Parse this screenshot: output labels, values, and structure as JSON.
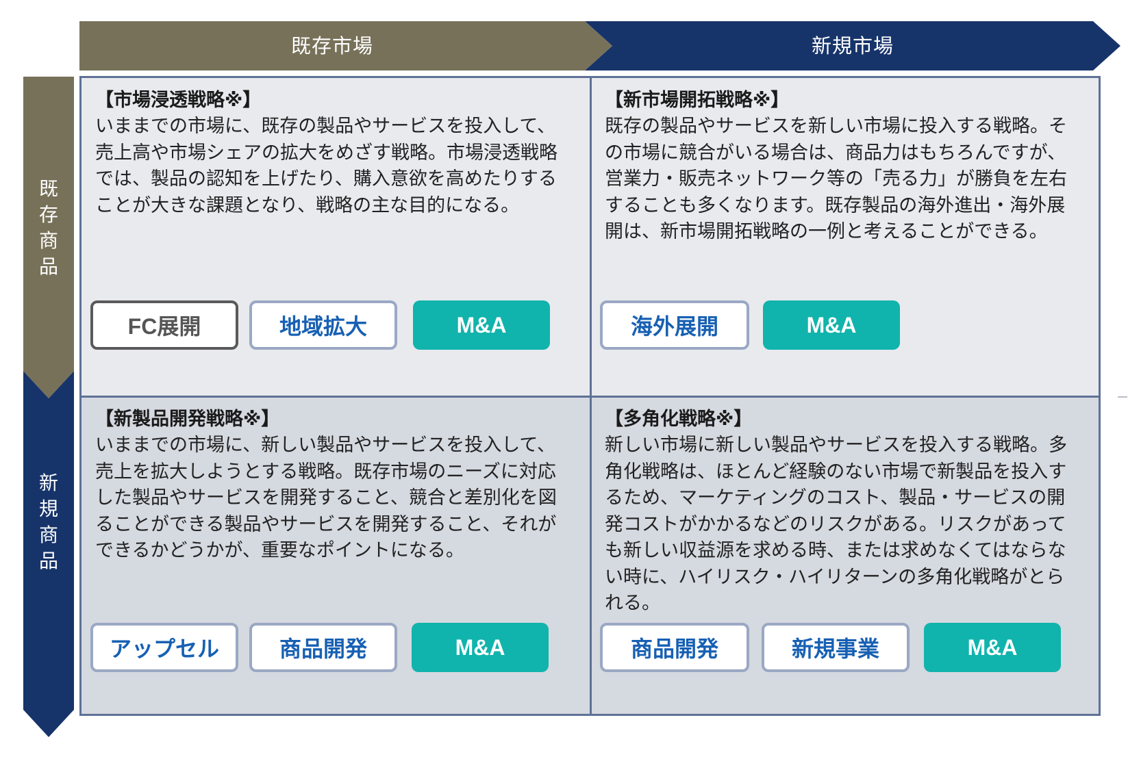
{
  "columns": {
    "existing_market": "既存市場",
    "new_market": "新規市場"
  },
  "rows": {
    "existing_product": "既存商品",
    "new_product": "新規商品"
  },
  "colors": {
    "olive": "#777159",
    "navy": "#17346a",
    "teal": "#10b4ac",
    "blue_text": "#1760b3",
    "border": "#5e7196"
  },
  "cells": {
    "market_penetration": {
      "title": "【市場浸透戦略※】",
      "body": "いままでの市場に、既存の製品やサービスを投入して、売上高や市場シェアの拡大をめざす戦略。市場浸透戦略では、製品の認知を上げたり、購入意欲を高めたりすることが大きな課題となり、戦略の主な目的になる。",
      "buttons": [
        "FC展開",
        "地域拡大",
        "M&A"
      ]
    },
    "market_development": {
      "title": "【新市場開拓戦略※】",
      "body": "既存の製品やサービスを新しい市場に投入する戦略。その市場に競合がいる場合は、商品力はもちろんですが、営業力・販売ネットワーク等の「売る力」が勝負を左右することも多くなります。既存製品の海外進出・海外展開は、新市場開拓戦略の一例と考えることができる。",
      "buttons": [
        "海外展開",
        "M&A"
      ]
    },
    "product_development": {
      "title": "【新製品開発戦略※】",
      "body": "いままでの市場に、新しい製品やサービスを投入して、売上を拡大しようとする戦略。既存市場のニーズに対応した製品やサービスを開発すること、競合と差別化を図ることができる製品やサービスを開発すること、それができるかどうかが、重要なポイントになる。",
      "buttons": [
        "アップセル",
        "商品開発",
        "M&A"
      ]
    },
    "diversification": {
      "title": "【多角化戦略※】",
      "body": "新しい市場に新しい製品やサービスを投入する戦略。多角化戦略は、ほとんど経験のない市場で新製品を投入するため、マーケティングのコスト、製品・サービスの開発コストがかかるなどのリスクがある。リスクがあっても新しい収益源を求める時、または求めなくてはならない時に、ハイリスク・ハイリターンの多角化戦略がとられる。",
      "buttons": [
        "商品開発",
        "新規事業",
        "M&A"
      ]
    }
  }
}
